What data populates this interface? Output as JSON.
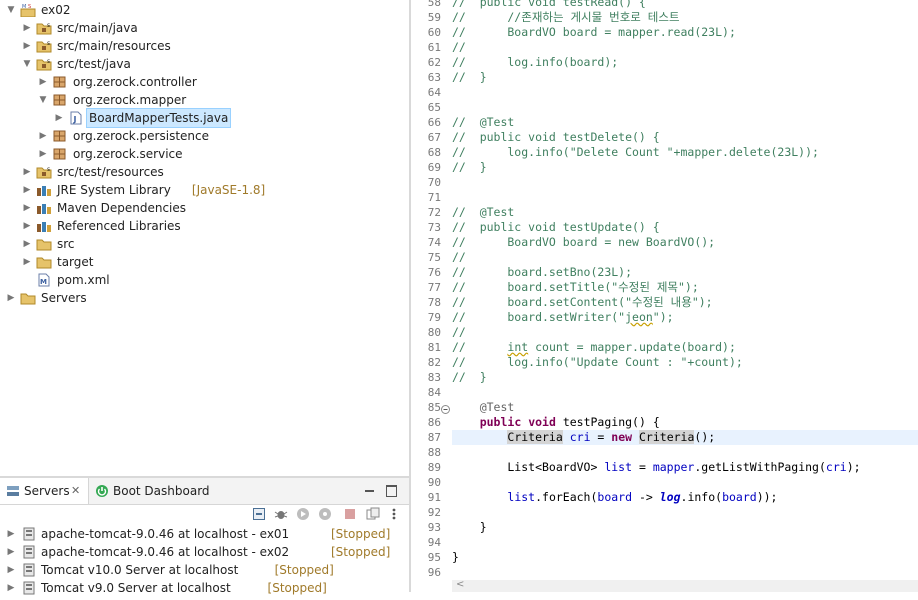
{
  "explorer": {
    "items": [
      {
        "label": "ex02",
        "icon": "maven-project-icon",
        "depth": 0,
        "expanded": true,
        "decoration": ""
      },
      {
        "label": "src/main/java",
        "icon": "source-folder-icon",
        "depth": 1,
        "expanded": false,
        "decoration": ""
      },
      {
        "label": "src/main/resources",
        "icon": "source-folder-icon",
        "depth": 1,
        "expanded": false,
        "decoration": ""
      },
      {
        "label": "src/test/java",
        "icon": "source-folder-icon",
        "depth": 1,
        "expanded": true,
        "decoration": ""
      },
      {
        "label": "org.zerock.controller",
        "icon": "package-icon",
        "depth": 2,
        "expanded": false,
        "decoration": ""
      },
      {
        "label": "org.zerock.mapper",
        "icon": "package-icon",
        "depth": 2,
        "expanded": true,
        "decoration": ""
      },
      {
        "label": "BoardMapperTests.java",
        "icon": "java-file-icon",
        "depth": 3,
        "expanded": false,
        "decoration": "",
        "selected": true
      },
      {
        "label": "org.zerock.persistence",
        "icon": "package-icon",
        "depth": 2,
        "expanded": false,
        "decoration": ""
      },
      {
        "label": "org.zerock.service",
        "icon": "package-icon",
        "depth": 2,
        "expanded": false,
        "decoration": ""
      },
      {
        "label": "src/test/resources",
        "icon": "source-folder-icon",
        "depth": 1,
        "expanded": false,
        "decoration": ""
      },
      {
        "label": "JRE System Library",
        "icon": "library-icon",
        "depth": 1,
        "expanded": false,
        "decoration": "[JavaSE-1.8]"
      },
      {
        "label": "Maven Dependencies",
        "icon": "library-icon",
        "depth": 1,
        "expanded": false,
        "decoration": ""
      },
      {
        "label": "Referenced Libraries",
        "icon": "library-icon",
        "depth": 1,
        "expanded": false,
        "decoration": ""
      },
      {
        "label": "src",
        "icon": "folder-icon",
        "depth": 1,
        "expanded": false,
        "decoration": ""
      },
      {
        "label": "target",
        "icon": "folder-icon",
        "depth": 1,
        "expanded": false,
        "decoration": ""
      },
      {
        "label": "pom.xml",
        "icon": "xml-file-icon",
        "depth": 1,
        "leaf": true,
        "decoration": ""
      },
      {
        "label": "Servers",
        "icon": "folder-icon",
        "depth": 0,
        "expanded": false,
        "decoration": ""
      }
    ]
  },
  "bottom_view": {
    "tabs": [
      {
        "label": "Servers",
        "close": "✕"
      },
      {
        "label": "Boot Dashboard"
      }
    ],
    "servers": [
      {
        "name": "apache-tomcat-9.0.46 at localhost - ex01",
        "status": "[Stopped]"
      },
      {
        "name": "apache-tomcat-9.0.46 at localhost - ex02",
        "status": "[Stopped]"
      },
      {
        "name": "Tomcat v10.0 Server at localhost",
        "status": "[Stopped]"
      },
      {
        "name": "Tomcat v9.0 Server at localhost",
        "status": "[Stopped]"
      }
    ]
  },
  "editor": {
    "first_line": 58,
    "current_line": 87,
    "lines": [
      [
        [
          "//  public void testRead() {",
          "c"
        ]
      ],
      [
        [
          "//      //존재하는 게시물 번호로 테스트",
          "c"
        ]
      ],
      [
        [
          "//      BoardVO board = mapper.read(23L);",
          "c"
        ]
      ],
      [
        [
          "//",
          "c"
        ]
      ],
      [
        [
          "//      log.info(board);",
          "c"
        ]
      ],
      [
        [
          "//  }",
          "c"
        ]
      ],
      [],
      [],
      [
        [
          "//  @Test",
          "c"
        ]
      ],
      [
        [
          "//  public void testDelete() {",
          "c"
        ]
      ],
      [
        [
          "//      log.info(\"Delete Count \"+mapper.delete(23L));",
          "c"
        ]
      ],
      [
        [
          "//  }",
          "c"
        ]
      ],
      [],
      [],
      [
        [
          "//  @Test",
          "c"
        ]
      ],
      [
        [
          "//  public void testUpdate() {",
          "c"
        ]
      ],
      [
        [
          "//      BoardVO board = new BoardVO();",
          "c"
        ]
      ],
      [
        [
          "//",
          "c"
        ]
      ],
      [
        [
          "//      board.setBno(23L);",
          "c"
        ]
      ],
      [
        [
          "//      board.setTitle(\"수정된 제목\");",
          "c"
        ]
      ],
      [
        [
          "//      board.setContent(\"수정된 내용\");",
          "c"
        ]
      ],
      [
        [
          "//      board.setWriter(\"",
          "c"
        ],
        [
          "jeon",
          "c squig"
        ],
        [
          "\");",
          "c"
        ]
      ],
      [
        [
          "//",
          "c"
        ]
      ],
      [
        [
          "//      ",
          "c"
        ],
        [
          "int",
          "c squig"
        ],
        [
          " count = mapper.update(board);",
          "c"
        ]
      ],
      [
        [
          "//      log.info(\"Update Count : \"+count);",
          "c"
        ]
      ],
      [
        [
          "//  }",
          "c"
        ]
      ],
      [],
      [
        [
          "    "
        ],
        [
          "@Test",
          "an"
        ]
      ],
      [
        [
          "    "
        ],
        [
          "public",
          "kw"
        ],
        [
          " "
        ],
        [
          "void",
          "kw"
        ],
        [
          " testPaging() {"
        ]
      ],
      [
        [
          "        "
        ],
        [
          "Criteria",
          "hl"
        ],
        [
          " "
        ],
        [
          "cri",
          "fd"
        ],
        [
          " = "
        ],
        [
          "new",
          "kw"
        ],
        [
          " "
        ],
        [
          "Criteria",
          "hl"
        ],
        [
          "();"
        ]
      ],
      [],
      [
        [
          "        List<BoardVO> "
        ],
        [
          "list",
          "fd"
        ],
        [
          " = "
        ],
        [
          "mapper",
          "fd"
        ],
        [
          ".getListWithPaging("
        ],
        [
          "cri",
          "fd"
        ],
        [
          ");"
        ]
      ],
      [],
      [
        [
          "        "
        ],
        [
          "list",
          "fd"
        ],
        [
          ".forEach("
        ],
        [
          "board",
          "fd"
        ],
        [
          " -> "
        ],
        [
          "log",
          "sf"
        ],
        [
          ".info("
        ],
        [
          "board",
          "fd"
        ],
        [
          "));"
        ]
      ],
      [],
      [
        [
          "    }"
        ]
      ],
      [],
      [
        [
          "}"
        ]
      ],
      []
    ]
  }
}
